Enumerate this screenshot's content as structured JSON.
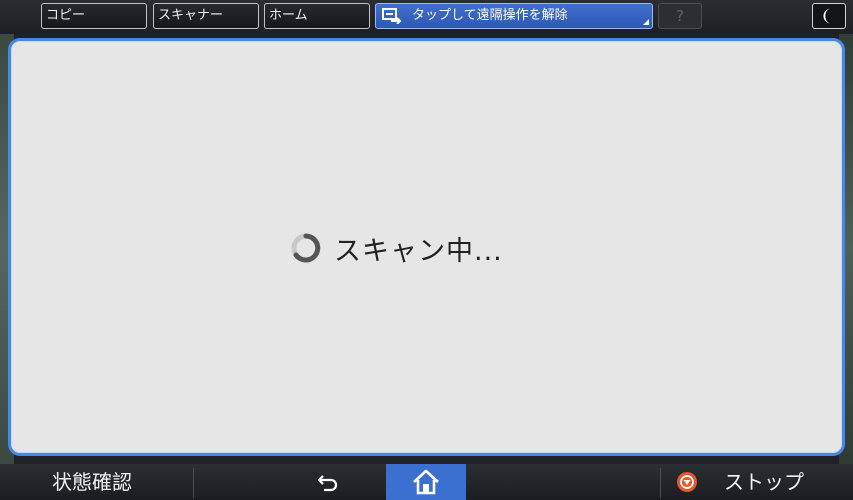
{
  "topbar": {
    "tabs": [
      {
        "label": "コピー"
      },
      {
        "label": "スキャナー"
      },
      {
        "label": "ホーム"
      }
    ],
    "remote_label": "タップして遠隔操作を解除",
    "help_label": "?"
  },
  "dialog": {
    "status_text": "スキャン中..."
  },
  "bottombar": {
    "status_label": "状態確認",
    "stop_label": "ストップ"
  },
  "colors": {
    "accent": "#4a86e8",
    "home_active": "#3b6fd0",
    "stop": "#e8562a"
  },
  "icons": [
    "remote-operation-icon",
    "moon-icon",
    "spinner-icon",
    "back-arrow-icon",
    "home-icon",
    "stop-icon"
  ]
}
